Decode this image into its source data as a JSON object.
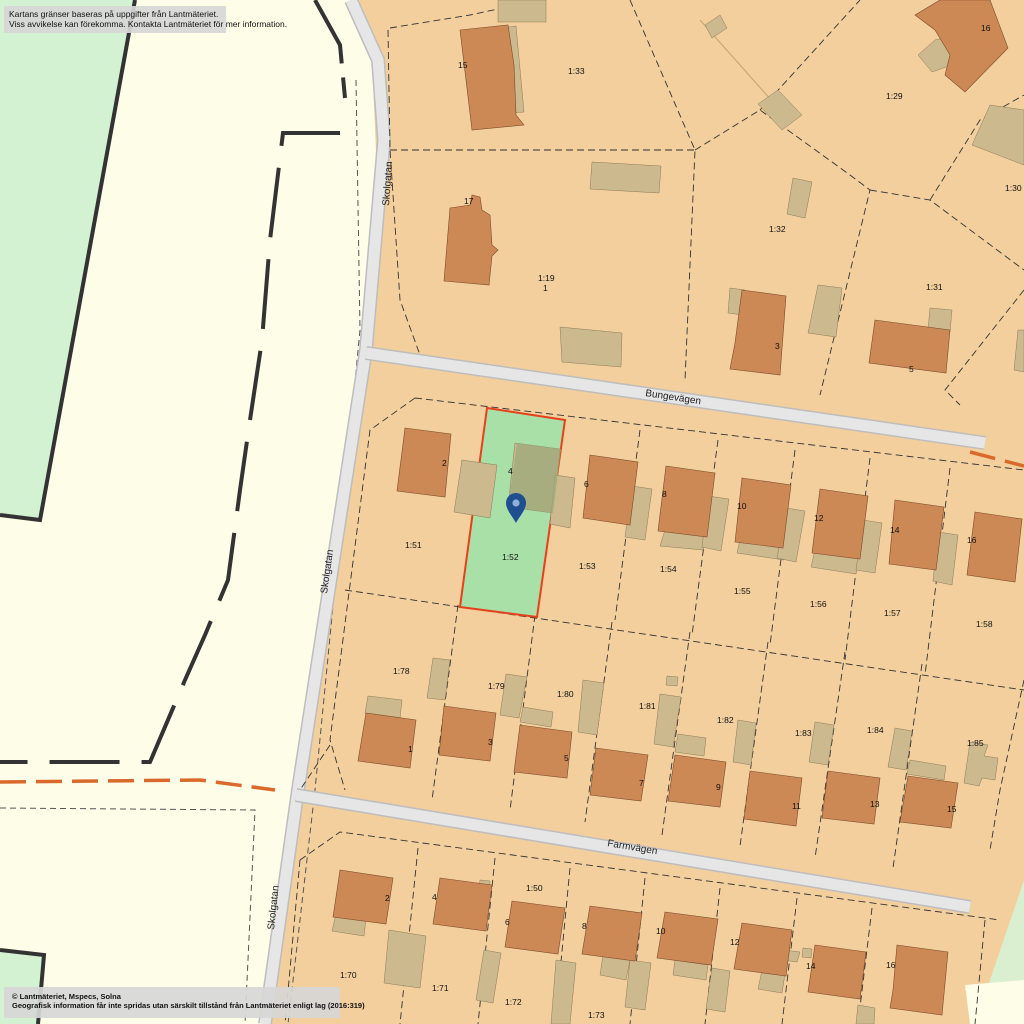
{
  "attribution": {
    "top": [
      "Kartans gränser baseras på uppgifter från Lantmäteriet.",
      "Viss avvikelse kan förekomma. Kontakta Lantmäteriet för mer information."
    ],
    "bottom": [
      "© Lantmäteriet, Mspecs, Solna",
      "Geografisk information får inte spridas utan särskilt tillstånd från Lantmäteriet enligt lag (2016:319)"
    ]
  },
  "streets": {
    "skolgatan": "Skolgatan",
    "bungevagen": "Bungevägen",
    "farmvagen": "Farmvägen"
  },
  "parcels": [
    "1:33",
    "1:29",
    "1:30",
    "1:19",
    "1:32",
    "1:31",
    "1:51",
    "1:52",
    "1:53",
    "1:54",
    "1:55",
    "1:56",
    "1:57",
    "1:58",
    "1:78",
    "1:79",
    "1:80",
    "1:81",
    "1:82",
    "1:83",
    "1:84",
    "1:85",
    "1:50",
    "1:70",
    "1:71",
    "1:72",
    "1:73"
  ],
  "house_numbers": {
    "north": [
      "15",
      "16",
      "17",
      "1",
      "3",
      "5"
    ],
    "bungevagen": [
      "2",
      "4",
      "6",
      "8",
      "10",
      "12",
      "14",
      "16"
    ],
    "farmvagen_north": [
      "1",
      "3",
      "5",
      "7",
      "9",
      "11",
      "13",
      "15"
    ],
    "farmvagen_south": [
      "2",
      "4",
      "6",
      "8",
      "10",
      "12",
      "14",
      "16"
    ]
  },
  "selected_parcel": {
    "label": "1:52",
    "house_number": "4"
  },
  "colors": {
    "land": "#f2cf9c",
    "public_land": "#fefde8",
    "green": "#d2f2d2",
    "building": "#cc8855",
    "outbuilding": "#cdb98e",
    "road": "#e4e4e4",
    "boundary_orange": "#d96a2b",
    "selected_fill": "#a8e0a8",
    "marker": "#1f4f8f"
  },
  "marker_icon": "map-pin-icon"
}
